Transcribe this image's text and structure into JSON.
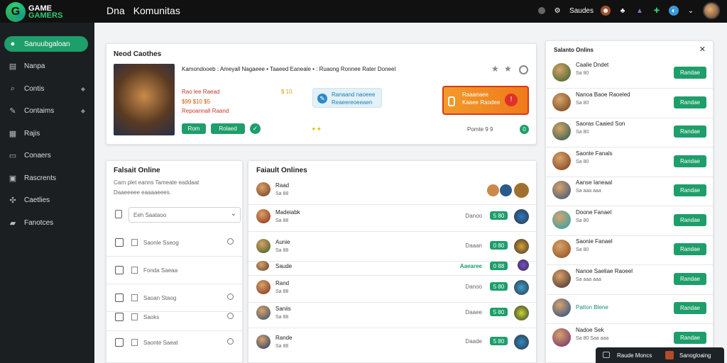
{
  "topbar": {
    "logo_line1": "GAME",
    "logo_line2": "GAMERS",
    "title_a": "Dna",
    "title_b": "Komunitas",
    "user_label": "Saudes"
  },
  "sidebar": [
    {
      "label": "Sanuubgaloan",
      "icon": "user-icon",
      "active": true
    },
    {
      "label": "Nanpa",
      "icon": "book-icon"
    },
    {
      "label": "Contis",
      "icon": "search-icon",
      "chev": true
    },
    {
      "label": "Contaims",
      "icon": "pen-icon",
      "chev": true
    },
    {
      "label": "Rajis",
      "icon": "chart-icon"
    },
    {
      "label": "Conaers",
      "icon": "grid-icon"
    },
    {
      "label": "Rascrents",
      "icon": "gamepad-icon"
    },
    {
      "label": "Caetlies",
      "icon": "puzzle-icon"
    },
    {
      "label": "Fanotces",
      "icon": "folder-icon"
    }
  ],
  "featured": {
    "heading": "Neod Caothes",
    "title": "Kamondooeb : Ameyall Nagaeee • Taaeed Eaneale • : Ruaong Ronnee Rater Doneel",
    "line1": "Rao lee Raead",
    "line2": "$99 $10 $5",
    "line3": "Repoannall Raand",
    "mid1": "$ 10",
    "info_line1": "Ranaand naoeee",
    "info_line2": "Reaeereoeeaen",
    "orange_line1": "Raaanaee",
    "orange_line2": "Kaaee Raodee",
    "btn1": "Rom",
    "btn2": "Rolaed",
    "footer": "Pomte 9 9"
  },
  "left_panel": {
    "title": "Falsait Online",
    "desc_line1": "Carn plet eanns Tameate eaddaat",
    "desc_line2": "Daaeeeee eaaaaeees.",
    "select_placeholder": "Eeh Saataoo",
    "items": [
      {
        "label": "Saonle Sseog"
      },
      {
        "label": "Fonda Saeaa"
      },
      {
        "label": "Saoan Staog"
      },
      {
        "label": "Saoks"
      },
      {
        "label": "Saonte Saeat"
      }
    ]
  },
  "center_panel": {
    "title": "Faiault Onlines",
    "rows": [
      {
        "name": "Raad",
        "sub": "Sa 88",
        "right": "",
        "btn": "",
        "color": "#6d3a1e"
      },
      {
        "name": "Madeiabk",
        "sub": "Sa 88",
        "right": "Danoo",
        "btn": "5 80",
        "color": "#8b2a16"
      },
      {
        "name": "Aunie",
        "sub": "Sa 88",
        "right": "Daaan",
        "btn": "0 80",
        "color": "#3a5a1c"
      },
      {
        "name": "Saude",
        "sub": "",
        "right": "Aaearee",
        "btn": "0 88",
        "color": "#58402a"
      },
      {
        "name": "Rand",
        "sub": "Sa 88",
        "right": "Danoo",
        "btn": "5 80",
        "color": "#7a3018"
      },
      {
        "name": "Saniis",
        "sub": "Sa 88",
        "right": "Daaee",
        "btn": "5 80",
        "color": "#2e4d6a"
      },
      {
        "name": "Rande",
        "sub": "Sa 88",
        "right": "Daade",
        "btn": "5 80",
        "color": "#1a3a6a"
      }
    ]
  },
  "right_panel": {
    "title": "Salanto Onlins",
    "rows": [
      {
        "name": "Caalie Dndet",
        "sub": "Sa 80",
        "btn": "Randae",
        "color": "#2f5f2a"
      },
      {
        "name": "Nanoa Baoe Raoeled",
        "sub": "Sa 80",
        "btn": "Randae",
        "color": "#6a3f1a"
      },
      {
        "name": "Saoras Caaied Son",
        "sub": "Sa 80",
        "btn": "Randae",
        "color": "#1e5a48"
      },
      {
        "name": "Saonte Fanals",
        "sub": "Sa 80",
        "btn": "Randae",
        "color": "#7a3a1a"
      },
      {
        "name": "Aanse Ianeaal",
        "sub": "Sa aaa aaa",
        "btn": "Randae",
        "color": "#2e4f7a"
      },
      {
        "name": "Doone Fanael",
        "sub": "Sa 80",
        "btn": "Randae",
        "color": "#1aa3b3"
      },
      {
        "name": "Saonie Fanael",
        "sub": "Sa 80",
        "btn": "Randae",
        "color": "#8a4a1a"
      },
      {
        "name": "Nanoe Saeliae Raoeel",
        "sub": "Sa aaa aaa",
        "btn": "Randae",
        "color": "#3a2a2a"
      },
      {
        "name": "Patton Blene",
        "sub": "",
        "btn": "Randae",
        "color": "#1a4a8a"
      },
      {
        "name": "Nadoe Sek",
        "sub": "Sa 80 Saa aaa",
        "btn": "Randae",
        "color": "#6a2a6a"
      }
    ]
  },
  "bottom_bar": {
    "label1": "Raude Moncs",
    "label2": "Sanogloaing"
  }
}
